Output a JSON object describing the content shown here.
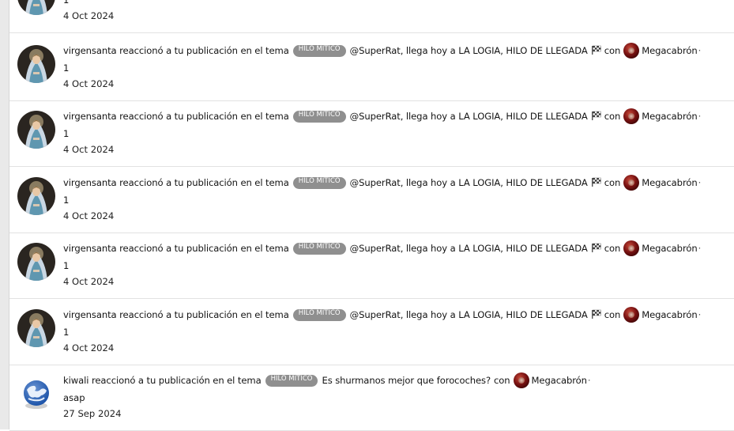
{
  "rows": [
    {
      "user": "",
      "action": "",
      "badge": "",
      "topic": "",
      "con": "",
      "reaction": "",
      "extra": "1",
      "date": "4 Oct 2024",
      "avatar_icon": "virgin-mary-avatar-icon"
    },
    {
      "user": "virgensanta",
      "action": "reaccionó a tu publicación en el tema",
      "badge": "HILO MÍTICO",
      "topic": "@SuperRat, llega hoy a LA LOGIA, HILO DE LLEGADA",
      "con": "con",
      "reaction": "Megacabrón",
      "extra": "1",
      "date": "4 Oct 2024",
      "avatar_icon": "virgin-mary-avatar-icon"
    },
    {
      "user": "virgensanta",
      "action": "reaccionó a tu publicación en el tema",
      "badge": "HILO MÍTICO",
      "topic": "@SuperRat, llega hoy a LA LOGIA, HILO DE LLEGADA",
      "con": "con",
      "reaction": "Megacabrón",
      "extra": "1",
      "date": "4 Oct 2024",
      "avatar_icon": "virgin-mary-avatar-icon"
    },
    {
      "user": "virgensanta",
      "action": "reaccionó a tu publicación en el tema",
      "badge": "HILO MÍTICO",
      "topic": "@SuperRat, llega hoy a LA LOGIA, HILO DE LLEGADA",
      "con": "con",
      "reaction": "Megacabrón",
      "extra": "1",
      "date": "4 Oct 2024",
      "avatar_icon": "virgin-mary-avatar-icon"
    },
    {
      "user": "virgensanta",
      "action": "reaccionó a tu publicación en el tema",
      "badge": "HILO MÍTICO",
      "topic": "@SuperRat, llega hoy a LA LOGIA, HILO DE LLEGADA",
      "con": "con",
      "reaction": "Megacabrón",
      "extra": "1",
      "date": "4 Oct 2024",
      "avatar_icon": "virgin-mary-avatar-icon"
    },
    {
      "user": "virgensanta",
      "action": "reaccionó a tu publicación en el tema",
      "badge": "HILO MÍTICO",
      "topic": "@SuperRat, llega hoy a LA LOGIA, HILO DE LLEGADA",
      "con": "con",
      "reaction": "Megacabrón",
      "extra": "1",
      "date": "4 Oct 2024",
      "avatar_icon": "virgin-mary-avatar-icon"
    },
    {
      "user": "kiwali",
      "action": "reaccionó a tu publicación en el tema",
      "badge": "HILO MÍTICO",
      "topic": "Es shurmanos mejor que forocoches?",
      "con": "con",
      "reaction": "Megacabrón",
      "extra": "asap",
      "date": "27 Sep 2024",
      "avatar_icon": "globe-avatar-icon"
    }
  ],
  "icons": {
    "flag": "checkered-flag-icon",
    "reaction": "megacabron-reaction-icon"
  },
  "colors": {
    "badge_bg": "#8f8f8f",
    "divider": "#e2e2e2",
    "rail": "#e9e9e9"
  }
}
